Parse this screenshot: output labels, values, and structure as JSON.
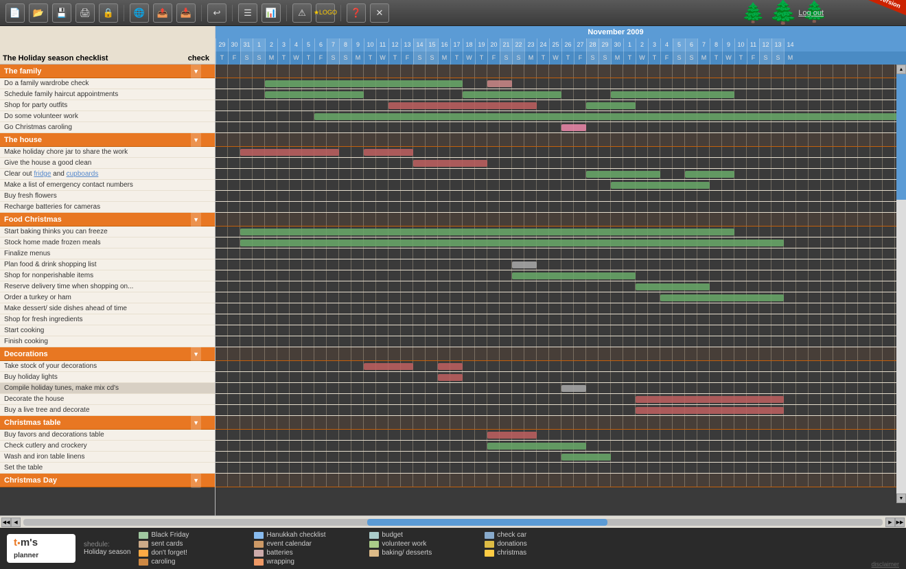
{
  "app": {
    "title": "Tom's Planner - Holiday Season",
    "beta_label": "BETA version"
  },
  "toolbar": {
    "buttons": [
      {
        "name": "new",
        "icon": "📄",
        "label": "New"
      },
      {
        "name": "open",
        "icon": "📁",
        "label": "Open"
      },
      {
        "name": "save",
        "icon": "💾",
        "label": "Save"
      },
      {
        "name": "print",
        "icon": "🖨",
        "label": "Print"
      },
      {
        "name": "lock",
        "icon": "🔒",
        "label": "Lock"
      },
      {
        "name": "share",
        "icon": "🌐",
        "label": "Share"
      },
      {
        "name": "export",
        "icon": "📤",
        "label": "Export"
      },
      {
        "name": "import",
        "icon": "📥",
        "label": "Import"
      },
      {
        "name": "undo",
        "icon": "↩",
        "label": "Undo"
      },
      {
        "name": "list",
        "icon": "☰",
        "label": "List"
      },
      {
        "name": "gantt",
        "icon": "📊",
        "label": "Gantt"
      },
      {
        "name": "alert",
        "icon": "⚠",
        "label": "Alert"
      },
      {
        "name": "logo",
        "icon": "★",
        "label": "Logo"
      },
      {
        "name": "help",
        "icon": "❓",
        "label": "Help"
      },
      {
        "name": "close",
        "icon": "✕",
        "label": "Close"
      }
    ],
    "logout_label": "Log out"
  },
  "calendar": {
    "month_label": "November 2009",
    "days": [
      29,
      30,
      31,
      1,
      2,
      3,
      4,
      5,
      6,
      7,
      8,
      9,
      10,
      11,
      12,
      13,
      14,
      15,
      16,
      17,
      18,
      19,
      20,
      21,
      22,
      23,
      24,
      25,
      26,
      27,
      28,
      29,
      30,
      1,
      2,
      3,
      4,
      5,
      6,
      7,
      8,
      9,
      10,
      11,
      12,
      13,
      14
    ],
    "day_letters": [
      "T",
      "F",
      "S",
      "S",
      "M",
      "T",
      "W",
      "T",
      "F",
      "S",
      "S",
      "M",
      "T",
      "W",
      "T",
      "F",
      "S",
      "S",
      "M",
      "T",
      "W",
      "T",
      "F",
      "S",
      "S",
      "M",
      "T",
      "W",
      "T",
      "F",
      "S",
      "S",
      "M",
      "T",
      "W",
      "T",
      "F",
      "S",
      "S",
      "M",
      "T",
      "W",
      "T",
      "F",
      "S",
      "S",
      "M"
    ]
  },
  "task_header": {
    "label": "The Holiday season checklist",
    "check_label": "check"
  },
  "sections": [
    {
      "id": "family",
      "label": "The family",
      "tasks": [
        "Do a family wardrobe check",
        "Schedule family haircut appointments",
        "Shop for party outfits",
        "Do some volunteer work",
        "Go Christmas caroling"
      ]
    },
    {
      "id": "house",
      "label": "The house",
      "tasks": [
        "Make holiday chore jar to share the work",
        "Give the house a good clean",
        "Clear out fridge and cupboards",
        "Make a list of emergency contact numbers",
        "Buy fresh flowers",
        "Recharge batteries for cameras"
      ]
    },
    {
      "id": "food",
      "label": "Food Christmas",
      "tasks": [
        "Start baking thinks you can freeze",
        "Stock home made frozen meals",
        "Finalize menus",
        "Plan food & drink shopping list",
        "Shop for nonperishable items",
        "Reserve delivery time when shopping on...",
        "Order a turkey or ham",
        "Make dessert/ side dishes ahead of time",
        "Shop for fresh ingredients",
        "Start cooking",
        "Finish cooking"
      ]
    },
    {
      "id": "decorations",
      "label": "Decorations",
      "tasks": [
        "Take stock of your decorations",
        "Buy holiday lights",
        "Compile holiday tunes, make mix cd's",
        "Decorate the house",
        "Buy a live tree and decorate"
      ]
    },
    {
      "id": "christmas_table",
      "label": "Christmas table",
      "tasks": [
        "Buy favors and decorations table",
        "Check cutlery and crockery",
        "Wash and iron table linens",
        "Set the table"
      ]
    },
    {
      "id": "christmas_day",
      "label": "Christmas Day",
      "tasks": []
    }
  ],
  "footer": {
    "schedule_label": "shedule:",
    "schedule_name": "Holiday season",
    "legend": [
      {
        "color": "#a0c8a0",
        "label": "Black Friday"
      },
      {
        "color": "#88bbee",
        "label": "Hanukkah checklist"
      },
      {
        "color": "#aacccc",
        "label": "budget"
      },
      {
        "color": "#88aacc",
        "label": "check car"
      },
      {
        "color": "#ccaa88",
        "label": "sent cards"
      },
      {
        "color": "#cc9966",
        "label": "event calendar"
      },
      {
        "color": "#aacc88",
        "label": "volunteer work"
      },
      {
        "color": "#ddbb44",
        "label": "donations"
      },
      {
        "color": "#ffaa44",
        "label": "don't forget!"
      },
      {
        "color": "#ccaaaa",
        "label": "batteries"
      },
      {
        "color": "#ddbb88",
        "label": "baking/ desserts"
      },
      {
        "color": "#ffcc44",
        "label": "christmas"
      },
      {
        "color": "#cc8844",
        "label": "caroling"
      },
      {
        "color": "#ee9966",
        "label": "wrapping"
      }
    ],
    "disclaimer": "disclaimer"
  }
}
